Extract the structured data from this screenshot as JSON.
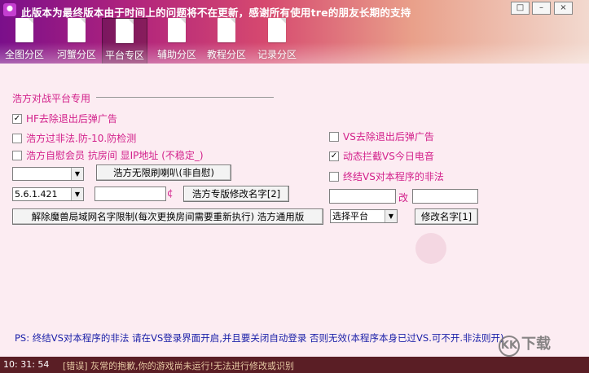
{
  "window": {
    "title": "此版本为最终版本由于时间上的问题将不在更新，感谢所有使用tre的朋友长期的支持",
    "controls": [
      "restore-icon",
      "minimize-icon",
      "close-icon"
    ]
  },
  "nav": [
    {
      "label": "全图分区"
    },
    {
      "label": "河蟹分区"
    },
    {
      "label": "平台专区"
    },
    {
      "label": "辅助分区"
    },
    {
      "label": "教程分区"
    },
    {
      "label": "记录分区"
    }
  ],
  "section": {
    "title": "浩方对战平台专用"
  },
  "checkboxes": {
    "hf_remove_ad": {
      "label": "HF去除退出后弹广告",
      "checked": true
    },
    "hf_bypass": {
      "label": "浩方过非法.防-10.防检测",
      "checked": false
    },
    "hf_vip": {
      "label": "浩方自慰会员  抗房间  显IP地址 (不稳定_)",
      "checked": false
    },
    "vs_remove_ad": {
      "label": "VS去除退出后弹广告",
      "checked": false
    },
    "vs_block": {
      "label": "动态拦截VS今日电音",
      "checked": true
    },
    "vs_terminate": {
      "label": "终结VS对本程序的非法",
      "checked": false
    }
  },
  "controls": {
    "dropdown1": {
      "value": ""
    },
    "btn_horn": {
      "label": "浩方无限刷喇叭(非自慰)"
    },
    "version_select": {
      "value": "5.6.1.421"
    },
    "name_input": {
      "value": ""
    },
    "color_symbol": "¢",
    "btn_rename_hf": {
      "label": "浩方专版修改名字[2]"
    },
    "btn_unlock": {
      "label": "解除魔兽局域网名字限制(每次更换房间需要重新执行) 浩方通用版"
    },
    "platform_select": {
      "value": "选择平台"
    },
    "btn_rename": {
      "label": "修改名字[1]"
    },
    "rename_from": {
      "value": ""
    },
    "rename_sep": "改",
    "rename_to": {
      "value": ""
    }
  },
  "notice": "PS: 终结VS对本程序的非法 请在VS登录界面开启,并且要关闭自动登录 否则无效(本程序本身已过VS.可不开.非法则开)",
  "status": {
    "time": "10: 31: 54",
    "message": "[错误] 灰常的抱歉,你的游戏尚未运行!无法进行修改或识别"
  },
  "watermark": {
    "text": "下载",
    "badge": "KK"
  },
  "colors": {
    "accent": "#d21f8a",
    "status_bg": "#5a1e25",
    "notice": "#1a1fa8"
  }
}
